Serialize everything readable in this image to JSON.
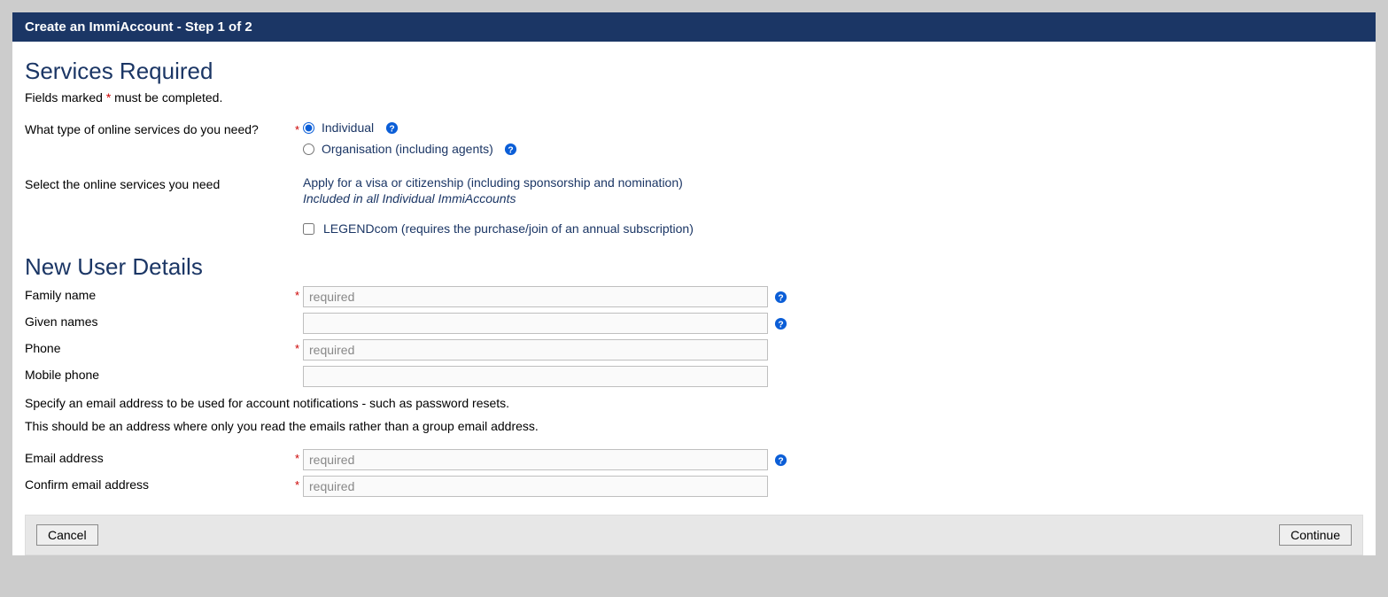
{
  "header": {
    "title": "Create an ImmiAccount - Step 1 of 2"
  },
  "services": {
    "heading": "Services Required",
    "fields_hint_pre": "Fields marked ",
    "fields_hint_star": "*",
    "fields_hint_post": " must be completed.",
    "type_question": "What type of online services do you need?",
    "radio_individual": "Individual",
    "radio_organisation": "Organisation (including agents)",
    "select_label": "Select the online services you need",
    "apply_text": "Apply for a visa or citizenship (including sponsorship and nomination)",
    "apply_note": "Included in all Individual ImmiAccounts",
    "legendcom_label": "LEGENDcom (requires the purchase/join of an annual subscription)"
  },
  "user": {
    "heading": "New User Details",
    "family_name_label": "Family name",
    "given_names_label": "Given names",
    "phone_label": "Phone",
    "mobile_label": "Mobile phone",
    "email_note1": "Specify an email address to be used for account notifications - such as password resets.",
    "email_note2": "This should be an address where only you read the emails rather than a group email address.",
    "email_label": "Email address",
    "confirm_email_label": "Confirm email address",
    "placeholder_required": "required"
  },
  "buttons": {
    "cancel": "Cancel",
    "continue": "Continue"
  },
  "star": "*"
}
